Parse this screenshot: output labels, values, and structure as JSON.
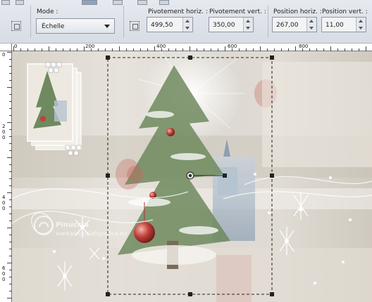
{
  "toolbar": {
    "mode_label": "Mode :",
    "mode_value": "Échelle",
    "pivot_h_label": "Pivotement horiz. :",
    "pivot_h_value": "499,50",
    "pivot_v_label": "Pivotement vert. :",
    "pivot_v_value": "350,00",
    "pos_h_label": "Position horiz. :",
    "pos_h_value": "267,00",
    "pos_v_label": "Position vert. :",
    "pos_v_value": "11,00"
  },
  "ruler_h_labels": [
    "0",
    "200",
    "400",
    "600",
    "800"
  ],
  "ruler_v_labels": [
    "0",
    "2\n0\n0",
    "4\n0\n0",
    "6\n0\n0"
  ],
  "watermark": "Pinuccia",
  "watermark_url": "www.pinucciafrgrafica.eu"
}
